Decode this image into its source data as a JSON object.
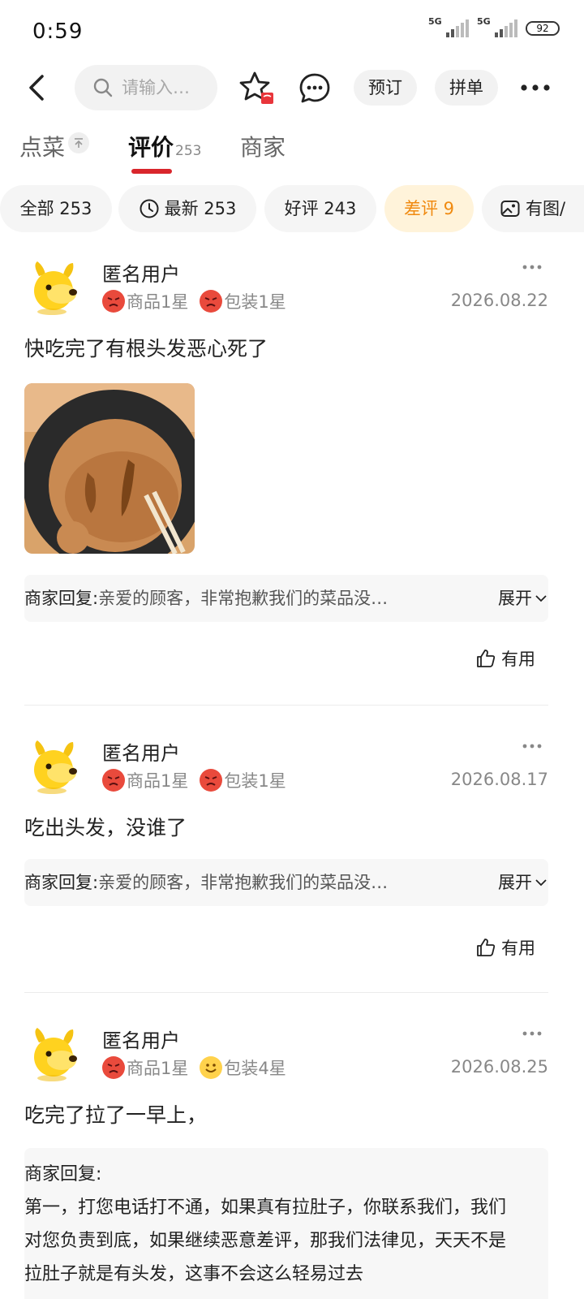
{
  "status": {
    "time": "0:59",
    "sig1": "5G",
    "sig2": "5G",
    "battery": "92"
  },
  "nav": {
    "search_placeholder": "请输入…",
    "book_label": "预订",
    "group_label": "拼单"
  },
  "tabs": {
    "dishes": "点菜",
    "reviews": "评价",
    "reviews_count": "253",
    "merchant": "商家"
  },
  "filters": [
    {
      "label": "全部 253"
    },
    {
      "label": "最新 253"
    },
    {
      "label": "好评 243"
    },
    {
      "label": "差评 9"
    },
    {
      "label": "有图/"
    }
  ],
  "reviews": [
    {
      "user": "匿名用户",
      "rating_product": "商品1星",
      "rating_package": "包装1星",
      "date": "2026.08.22",
      "text": "快吃完了有根头发恶心死了",
      "reply_label": "商家回复:",
      "reply_text": "亲爱的顾客，非常抱歉我们的菜品没…",
      "expand": "展开",
      "useful": "有用"
    },
    {
      "user": "匿名用户",
      "rating_product": "商品1星",
      "rating_package": "包装1星",
      "date": "2026.08.17",
      "text": "吃出头发，没谁了",
      "reply_label": "商家回复:",
      "reply_text": "亲爱的顾客，非常抱歉我们的菜品没…",
      "expand": "展开",
      "useful": "有用"
    },
    {
      "user": "匿名用户",
      "rating_product": "商品1星",
      "rating_package": "包装4星",
      "date": "2026.08.25",
      "text": "吃完了拉了一早上，",
      "reply_label": "商家回复:",
      "reply_line1": "第一，打您电话打不通，如果真有拉肚子，你联系我们，我们",
      "reply_line2": "对您负责到底，如果继续恶意差评，那我们法律见，天天不是",
      "reply_line3": "拉肚子就是有头发，这事不会这么轻易过去"
    }
  ],
  "colors": {
    "accent": "#d9262c",
    "bad_chip_bg": "#fff3da",
    "bad_chip_text": "#f08a10"
  }
}
